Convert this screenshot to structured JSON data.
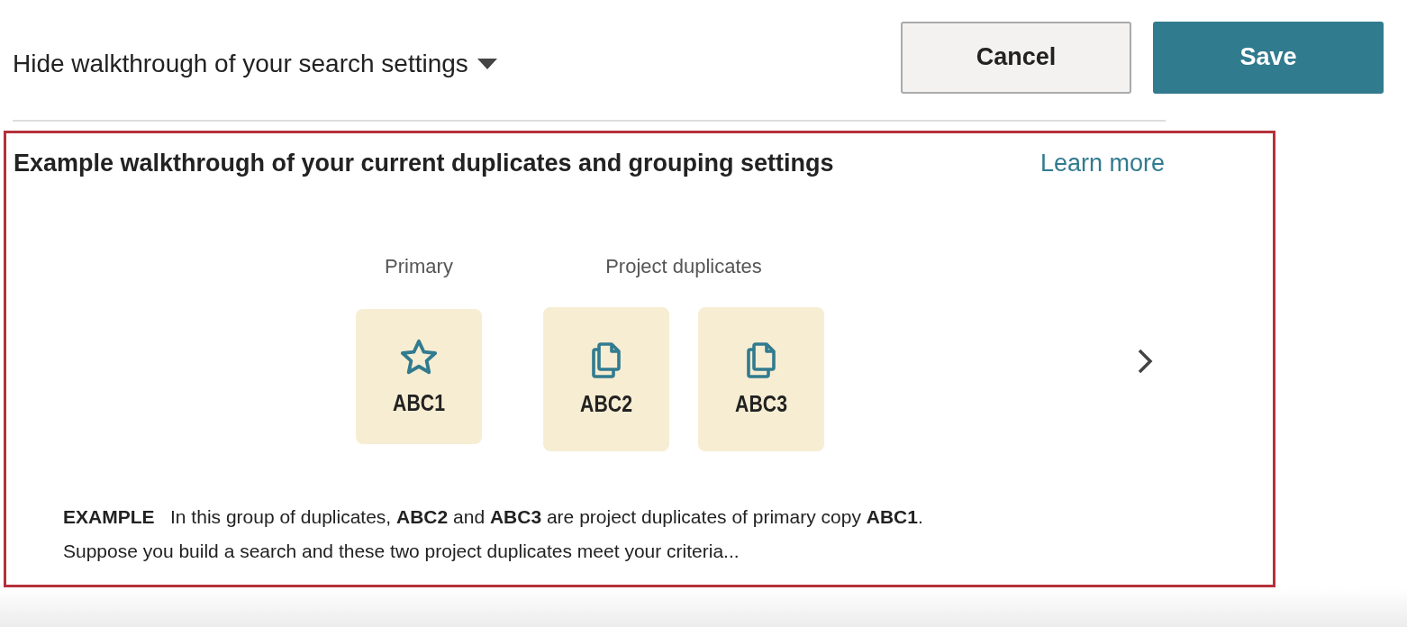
{
  "toggle": {
    "label": "Hide walkthrough of your search settings",
    "expanded": true
  },
  "buttons": [
    {
      "label": "Cancel",
      "kind": "secondary"
    },
    {
      "label": "Save",
      "kind": "primary"
    }
  ],
  "walkthrough": {
    "title": "Example walkthrough of your current duplicates and grouping settings",
    "link": "Learn more",
    "groups": [
      {
        "label": "Primary",
        "cards": [
          {
            "kind": "primary",
            "label": "ABC1"
          }
        ]
      },
      {
        "label": "Project duplicates",
        "cards": [
          {
            "kind": "duplicate",
            "label": "ABC2"
          },
          {
            "kind": "duplicate",
            "label": "ABC3"
          }
        ]
      }
    ],
    "lines": [
      "**EXAMPLE**   In this group of duplicates, **ABC2** and **ABC3** are project duplicates of primary copy **ABC1**.",
      "Suppose you build a search and these two project duplicates meet your criteria..."
    ]
  }
}
